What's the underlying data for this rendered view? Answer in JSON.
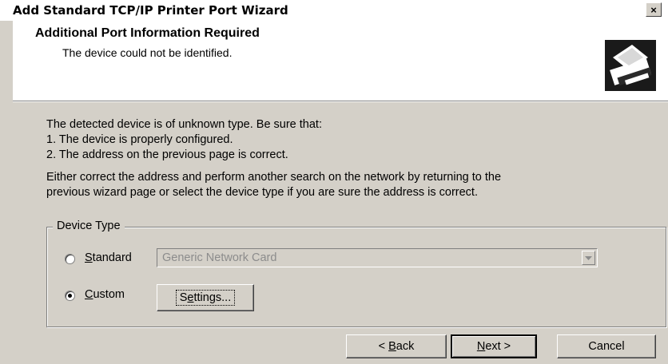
{
  "window": {
    "title": "Add Standard TCP/IP Printer Port Wizard",
    "close_glyph": "×"
  },
  "header": {
    "title": "Additional Port Information Required",
    "subtitle": "The device could not be identified.",
    "icon": "printer-port-icon"
  },
  "body": {
    "lines": [
      "The detected device is of unknown type.  Be sure that:",
      "1. The device is properly configured.",
      "2.  The address on the previous page is correct."
    ],
    "para2": [
      "Either correct the address and perform another search on the network by returning to the",
      "previous wizard page or select the device type if you are sure the address is correct."
    ]
  },
  "device_type": {
    "group_label": "Device Type",
    "standard": {
      "label_mn": "S",
      "label_rest": "tandard",
      "selected": false
    },
    "standard_combo": {
      "value": "Generic Network Card",
      "enabled": false
    },
    "custom": {
      "label_mn": "C",
      "label_rest": "ustom",
      "selected": true
    },
    "settings_button": {
      "pre": "S",
      "mn": "e",
      "post": "ttings..."
    }
  },
  "footer": {
    "back": {
      "pre": "< ",
      "mn": "B",
      "post": "ack"
    },
    "next": {
      "mn": "N",
      "post": "ext >"
    },
    "cancel": "Cancel"
  }
}
